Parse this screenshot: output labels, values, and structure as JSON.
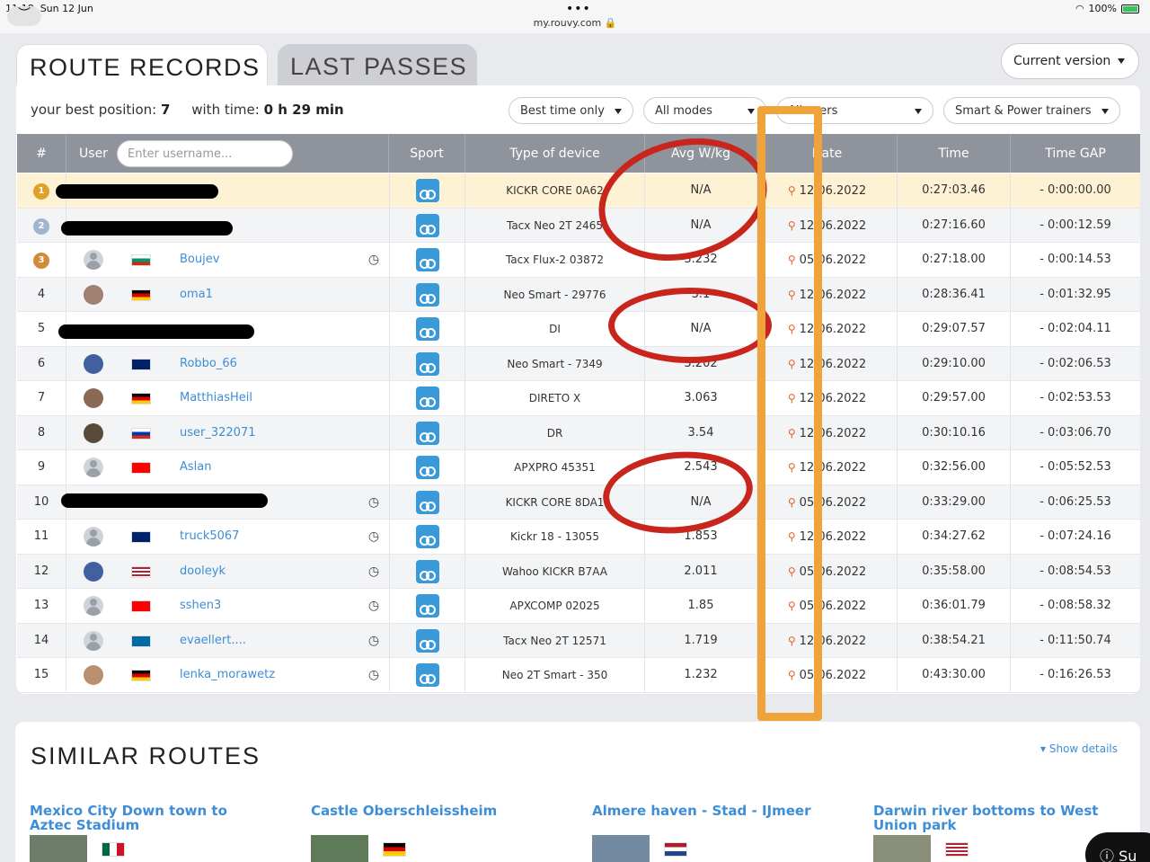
{
  "statusbar": {
    "time": "11:18",
    "date": "Sun 12 Jun",
    "url": "my.rouvy.com",
    "battery": "100%"
  },
  "tabs": {
    "active": "ROUTE RECORDS",
    "inactive": "LAST PASSES"
  },
  "version_select": "Current version",
  "best": {
    "position_label": "your best position:",
    "position": "7",
    "time_label": "with time:",
    "time": "0 h 29 min"
  },
  "filters": [
    "Best time only",
    "All modes",
    "All users",
    "Smart & Power trainers"
  ],
  "columns": {
    "rank": "#",
    "user": "User",
    "sport": "Sport",
    "device": "Type of device",
    "power": "Avg W/kg",
    "date": "Date",
    "time": "Time",
    "gap": "Time GAP"
  },
  "username_placeholder": "Enter username...",
  "rows": [
    {
      "rank": "1",
      "name": "",
      "device": "KICKR CORE 0A62",
      "power": "N/A",
      "date": "12.06.2022",
      "time": "0:27:03.46",
      "gap": "- 0:00:00.00"
    },
    {
      "rank": "2",
      "name": "",
      "device": "Tacx Neo 2T 2465",
      "power": "N/A",
      "date": "12.06.2022",
      "time": "0:27:16.60",
      "gap": "- 0:00:12.59"
    },
    {
      "rank": "3",
      "name": "Boujev",
      "device": "Tacx Flux-2 03872",
      "power": "3.232",
      "date": "05.06.2022",
      "time": "0:27:18.00",
      "gap": "- 0:00:14.53"
    },
    {
      "rank": "4",
      "name": "oma1",
      "device": "Neo Smart - 29776",
      "power": "3.1",
      "date": "12.06.2022",
      "time": "0:28:36.41",
      "gap": "- 0:01:32.95"
    },
    {
      "rank": "5",
      "name": "",
      "device": "DI",
      "power": "N/A",
      "date": "12.06.2022",
      "time": "0:29:07.57",
      "gap": "- 0:02:04.11"
    },
    {
      "rank": "6",
      "name": "Robbo_66",
      "device": "Neo Smart - 7349",
      "power": "3.202",
      "date": "12.06.2022",
      "time": "0:29:10.00",
      "gap": "- 0:02:06.53"
    },
    {
      "rank": "7",
      "name": "MatthiasHeil",
      "device": "DIRETO X",
      "power": "3.063",
      "date": "12.06.2022",
      "time": "0:29:57.00",
      "gap": "- 0:02:53.53"
    },
    {
      "rank": "8",
      "name": "user_322071",
      "device": "DR",
      "power": "3.54",
      "date": "12.06.2022",
      "time": "0:30:10.16",
      "gap": "- 0:03:06.70"
    },
    {
      "rank": "9",
      "name": "Aslan",
      "device": "APXPRO 45351",
      "power": "2.543",
      "date": "12.06.2022",
      "time": "0:32:56.00",
      "gap": "- 0:05:52.53"
    },
    {
      "rank": "10",
      "name": "",
      "device": "KICKR CORE 8DA1",
      "power": "N/A",
      "date": "05.06.2022",
      "time": "0:33:29.00",
      "gap": "- 0:06:25.53"
    },
    {
      "rank": "11",
      "name": "truck5067",
      "device": "Kickr 18 - 13055",
      "power": "1.853",
      "date": "12.06.2022",
      "time": "0:34:27.62",
      "gap": "- 0:07:24.16"
    },
    {
      "rank": "12",
      "name": "dooleyk",
      "device": "Wahoo KICKR B7AA",
      "power": "2.011",
      "date": "05.06.2022",
      "time": "0:35:58.00",
      "gap": "- 0:08:54.53"
    },
    {
      "rank": "13",
      "name": "sshen3",
      "device": "APXCOMP 02025",
      "power": "1.85",
      "date": "05.06.2022",
      "time": "0:36:01.79",
      "gap": "- 0:08:58.32"
    },
    {
      "rank": "14",
      "name": "evaellert....",
      "device": "Tacx Neo 2T 12571",
      "power": "1.719",
      "date": "12.06.2022",
      "time": "0:38:54.21",
      "gap": "- 0:11:50.74"
    },
    {
      "rank": "15",
      "name": "lenka_morawetz",
      "device": "Neo 2T Smart - 350",
      "power": "1.232",
      "date": "05.06.2022",
      "time": "0:43:30.00",
      "gap": "- 0:16:26.53"
    }
  ],
  "similar": {
    "title": "SIMILAR ROUTES",
    "show_details": "Show details",
    "routes": [
      "Mexico City Down town to Aztec Stadium",
      "Castle Oberschleissheim",
      "Almere haven - Stad - IJmeer",
      "Darwin river bottoms to West Union park"
    ]
  },
  "help": "Su",
  "colors": {
    "accent": "#3d8ed6",
    "header": "#8f949c",
    "annotation_red": "#c8261c",
    "annotation_orange": "#f0a33b"
  }
}
